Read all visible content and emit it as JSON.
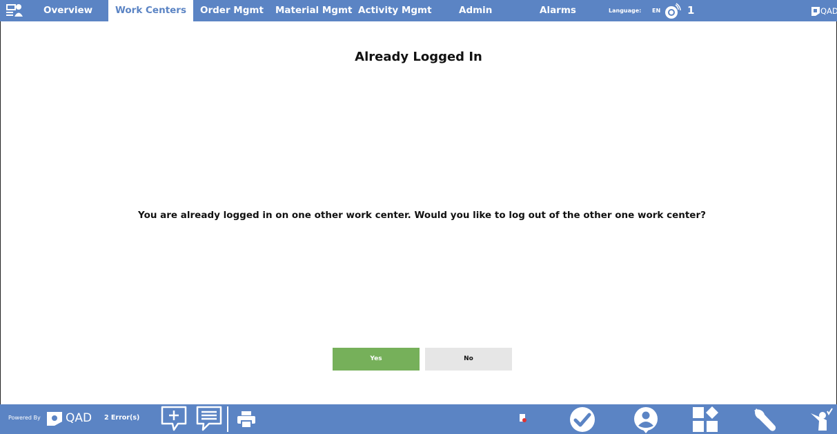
{
  "nav": {
    "tabs": [
      {
        "label": "Overview"
      },
      {
        "label": "Work Centers"
      },
      {
        "label": "Order Mgmt"
      },
      {
        "label": "Material Mgmt"
      },
      {
        "label": "Activity Mgmt"
      },
      {
        "label": "Admin"
      },
      {
        "label": "Alarms"
      }
    ],
    "language_label": "Language:",
    "language_value": "EN",
    "badge_count": "1",
    "brand": "QAD"
  },
  "dialog": {
    "title": "Already Logged In",
    "message": "You are already logged in on one other work center. Would you like to log out of the other one work center?",
    "yes_label": "Yes",
    "no_label": "No"
  },
  "footer": {
    "powered_by": "Powered By",
    "brand": "QAD",
    "errors": "2 Error(s)"
  },
  "colors": {
    "bar": "#5b84c4",
    "yes": "#76b05a",
    "no": "#e6e6e6"
  }
}
